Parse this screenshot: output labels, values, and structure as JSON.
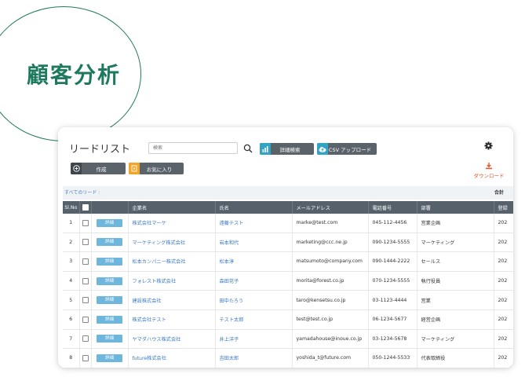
{
  "badge": {
    "title": "顧客分析"
  },
  "header": {
    "title": "リードリスト"
  },
  "search": {
    "placeholder": "検索"
  },
  "toolbar": {
    "detail_search": "詳細検索",
    "csv_upload": "CSV アップロード",
    "create": "作成",
    "favorite": "お気に入り",
    "download": "ダウンロード"
  },
  "filter": {
    "view": "すべてのリード",
    "total": "合計"
  },
  "table": {
    "columns": [
      "Sl.No",
      "",
      "",
      "企業名",
      "氏名",
      "メールアドレス",
      "電話番号",
      "部署",
      "登録"
    ],
    "detail_label": "詳細",
    "rows": [
      {
        "no": "1",
        "company": "株式会社マーケ",
        "name": "遠藤テスト",
        "email": "marke@test.com",
        "phone": "045-112-4456",
        "dept": "営業企画",
        "reg": "202"
      },
      {
        "no": "2",
        "company": "マーケティング株式会社",
        "name": "岩本和代",
        "email": "marketing@ccc.ne.jp",
        "phone": "090-1234-5555",
        "dept": "マーケティング",
        "reg": "202"
      },
      {
        "no": "3",
        "company": "松本カンパニー株式会社",
        "name": "松本淳",
        "email": "matsumoto@company.com",
        "phone": "090-1444-2222",
        "dept": "セールス",
        "reg": "202"
      },
      {
        "no": "4",
        "company": "フォレスト株式会社",
        "name": "森田花子",
        "email": "morita@forest.co.jp",
        "phone": "070-1234-5555",
        "dept": "執行役員",
        "reg": "202"
      },
      {
        "no": "5",
        "company": "建設株式会社",
        "name": "田中たろう",
        "email": "taro@kensetsu.co.jp",
        "phone": "03-1123-4444",
        "dept": "営業",
        "reg": "202"
      },
      {
        "no": "6",
        "company": "株式会社テスト",
        "name": "テスト太郎",
        "email": "test@test.co.jp",
        "phone": "06-1234-5677",
        "dept": "経営企画",
        "reg": "202"
      },
      {
        "no": "7",
        "company": "ヤマダハウス株式会社",
        "name": "井上洋子",
        "email": "yamadahouse@inoue.co.jp",
        "phone": "03-1234-5678",
        "dept": "マーケティング",
        "reg": "202"
      },
      {
        "no": "8",
        "company": "future株式会社",
        "name": "吉田太郎",
        "email": "yoshida_t@future.com",
        "phone": "050-1244-5533",
        "dept": "代表取締役",
        "reg": "202"
      }
    ]
  },
  "colors": {
    "accent": "#1e7a5e",
    "header_bg": "#56616b",
    "link": "#3a79c9",
    "detail_btn": "#6fb6dd",
    "download": "#e05a2b"
  }
}
